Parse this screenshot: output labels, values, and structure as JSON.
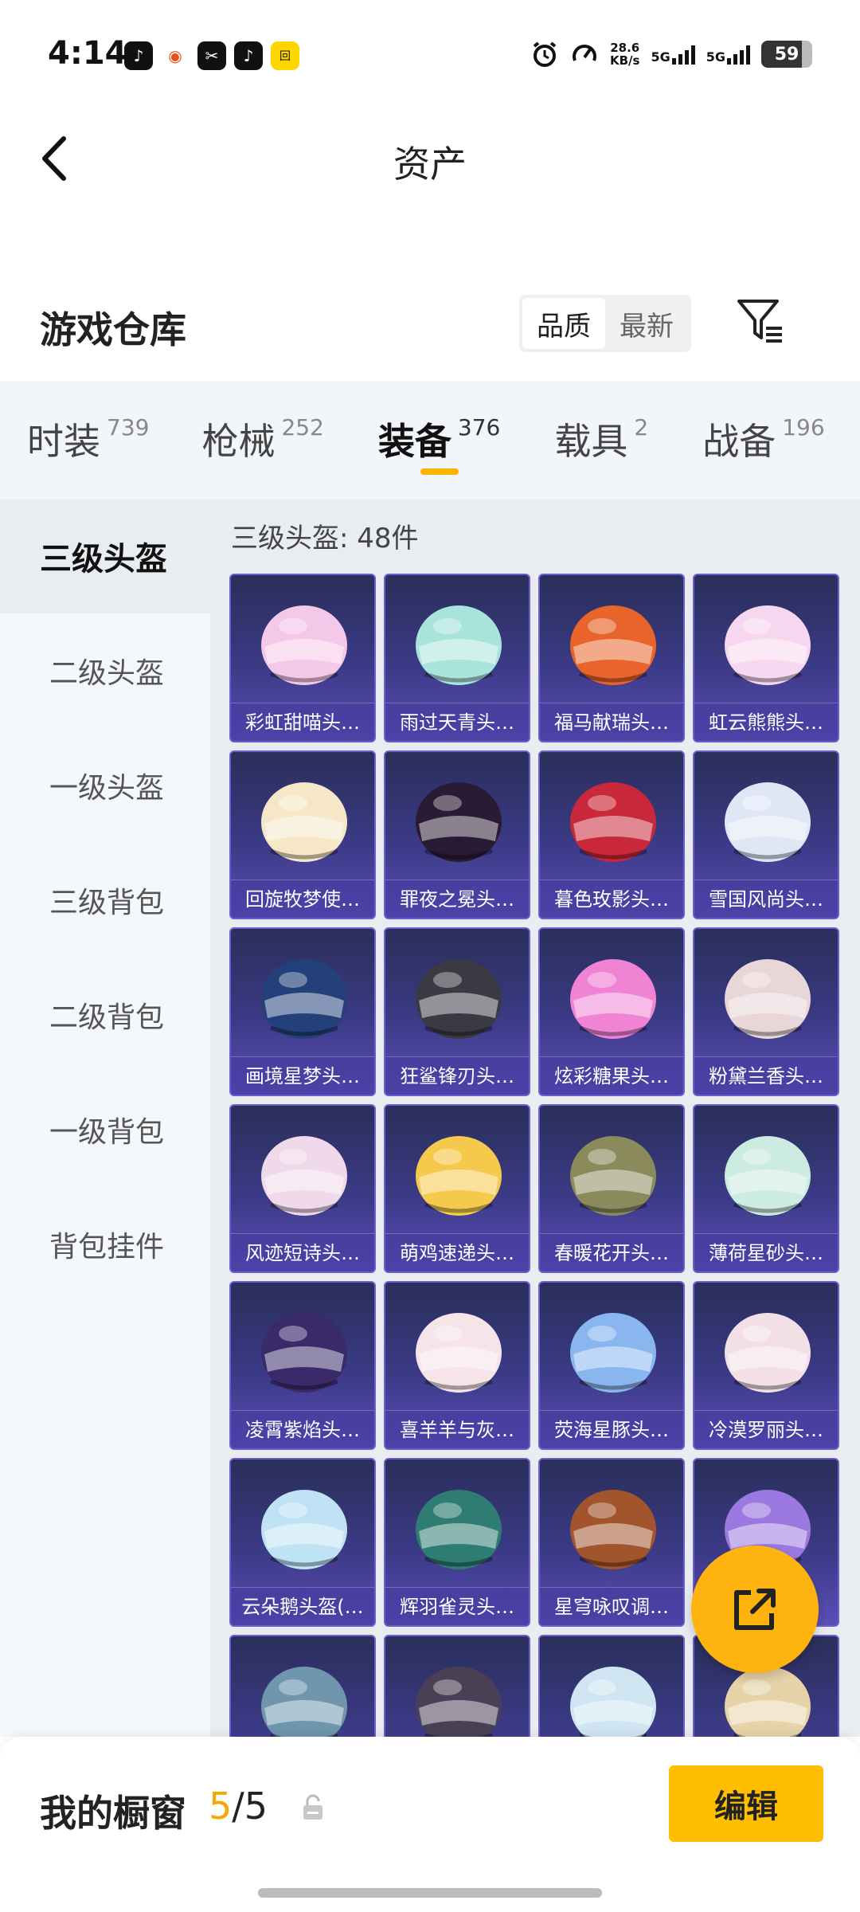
{
  "status_bar": {
    "time": "4:14",
    "apps": [
      "♪",
      "◉",
      "✂",
      "♪",
      "回"
    ],
    "speed_value": "28.6",
    "speed_unit": "KB/s",
    "net1": "5G",
    "net2": "5G",
    "battery": "59"
  },
  "header": {
    "title": "资产"
  },
  "section": {
    "title": "游戏仓库",
    "sort_options": [
      "品质",
      "最新"
    ],
    "sort_active": "品质"
  },
  "tabs": [
    {
      "label": "时装",
      "count": "739"
    },
    {
      "label": "枪械",
      "count": "252"
    },
    {
      "label": "装备",
      "count": "376"
    },
    {
      "label": "载具",
      "count": "2"
    },
    {
      "label": "战备",
      "count": "196"
    }
  ],
  "sidebar": [
    {
      "label": "三级头盔"
    },
    {
      "label": "二级头盔"
    },
    {
      "label": "一级头盔"
    },
    {
      "label": "三级背包"
    },
    {
      "label": "二级背包"
    },
    {
      "label": "一级背包"
    },
    {
      "label": "背包挂件"
    }
  ],
  "list_head": "三级头盔: 48件",
  "items": [
    {
      "name": "彩虹甜喵头…",
      "color": "#f4c8e8"
    },
    {
      "name": "雨过天青头…",
      "color": "#a9e4dc"
    },
    {
      "name": "福马献瑞头…",
      "color": "#e8642a"
    },
    {
      "name": "虹云熊熊头…",
      "color": "#f7d7ef"
    },
    {
      "name": "回旋牧梦使…",
      "color": "#f6e8c7"
    },
    {
      "name": "罪夜之冕头…",
      "color": "#2b1a34"
    },
    {
      "name": "暮色玫影头…",
      "color": "#c8283a"
    },
    {
      "name": "雪国风尚头…",
      "color": "#dfe7f6"
    },
    {
      "name": "画境星梦头…",
      "color": "#24407a"
    },
    {
      "name": "狂鲨锋刃头…",
      "color": "#3a3a44"
    },
    {
      "name": "炫彩糖果头…",
      "color": "#f083d4"
    },
    {
      "name": "粉黛兰香头…",
      "color": "#e9d6d8"
    },
    {
      "name": "风迹短诗头…",
      "color": "#f0d9ea"
    },
    {
      "name": "萌鸡速递头…",
      "color": "#f5c94b"
    },
    {
      "name": "春暖花开头…",
      "color": "#8a8a5c"
    },
    {
      "name": "薄荷星砂头…",
      "color": "#cdece1"
    },
    {
      "name": "凌霄紫焰头…",
      "color": "#3a2a6a"
    },
    {
      "name": "喜羊羊与灰…",
      "color": "#f6e4e8"
    },
    {
      "name": "荧海星豚头…",
      "color": "#8ab6ef"
    },
    {
      "name": "冷漠罗丽头…",
      "color": "#f2e0e6"
    },
    {
      "name": "云朵鹅头盔(…",
      "color": "#bfe3f4"
    },
    {
      "name": "辉羽雀灵头…",
      "color": "#2f7c72"
    },
    {
      "name": "星穹咏叹调…",
      "color": "#a2542c"
    },
    {
      "name": "",
      "color": "#9b79e0"
    },
    {
      "name": "",
      "color": "#6f96ad"
    },
    {
      "name": "",
      "color": "#4a4056"
    },
    {
      "name": "",
      "color": "#cfe6f2"
    },
    {
      "name": "",
      "color": "#e7d3a8"
    }
  ],
  "bottom": {
    "label": "我的橱窗",
    "current": "5",
    "separator": "/",
    "total": "5",
    "edit": "编辑"
  },
  "accent_color": "#ffbf00"
}
